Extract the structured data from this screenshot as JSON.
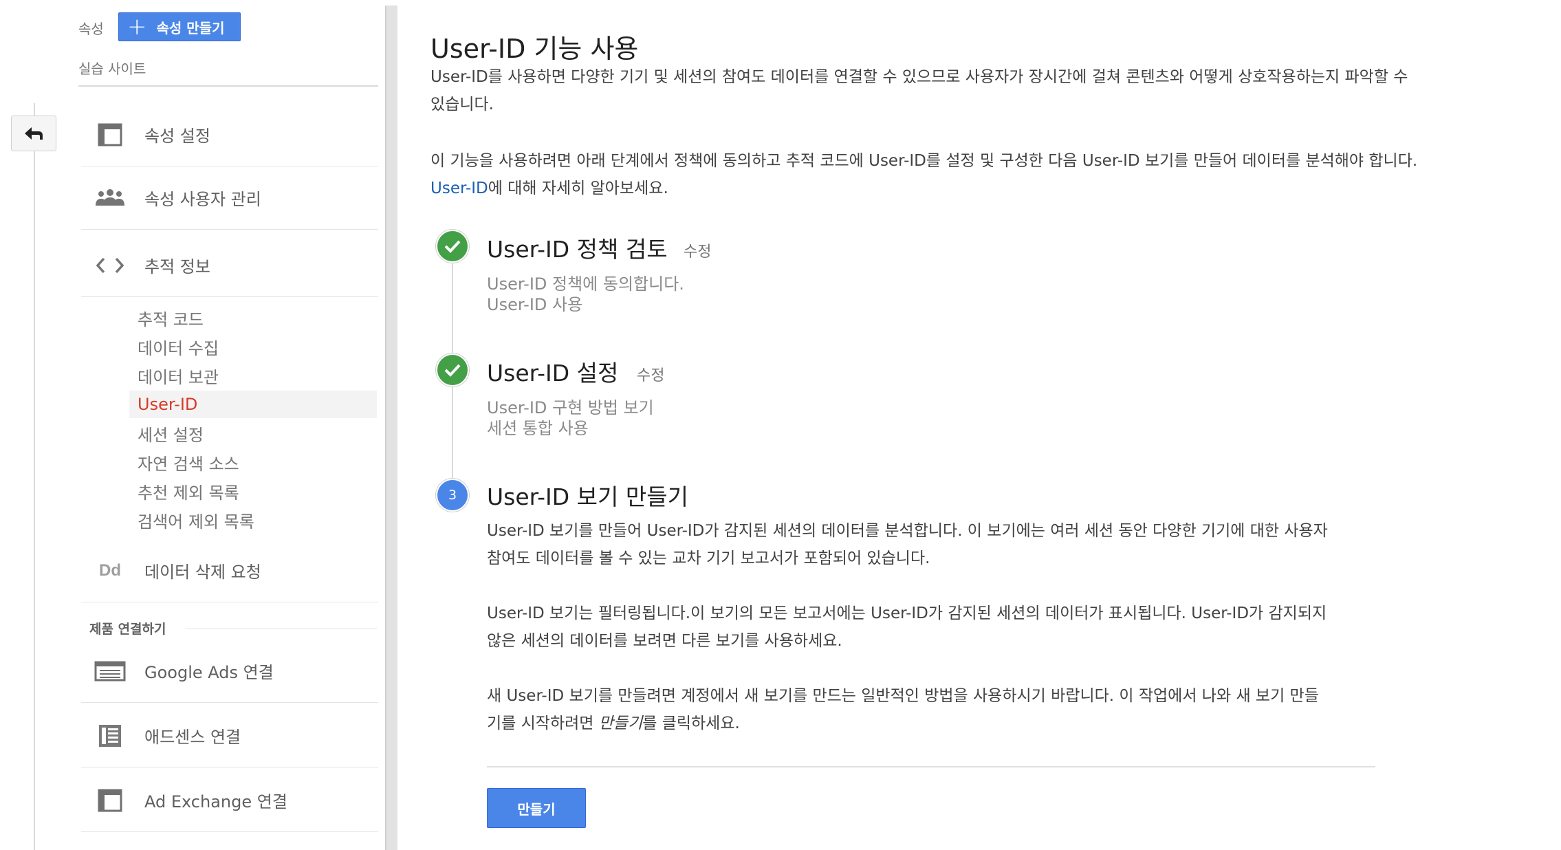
{
  "sidebar": {
    "property_label": "속성",
    "create_property_label": "속성 만들기",
    "site_name": "실습 사이트",
    "items": [
      {
        "label": "속성 설정"
      },
      {
        "label": "속성 사용자 관리"
      },
      {
        "label": "추적 정보"
      },
      {
        "label": "데이터 삭제 요청"
      },
      {
        "label": "Google Ads 연결"
      },
      {
        "label": "애드센스 연결"
      },
      {
        "label": "Ad Exchange 연결"
      }
    ],
    "subitems": [
      "추적 코드",
      "데이터 수집",
      "데이터 보관",
      "User-ID",
      "세션 설정",
      "자연 검색 소스",
      "추천 제외 목록",
      "검색어 제외 목록"
    ],
    "active_subitem": "User-ID",
    "section_label": "제품 연결하기"
  },
  "main": {
    "title": "User-ID 기능 사용",
    "intro_line1": "User-ID를 사용하면 다양한 기기 및 세션의 참여도 데이터를 연결할 수 있으므로 사용자가 장시간에 걸쳐 콘텐츠와 어떻게 상호작용하는지 파악할 수",
    "intro_line2": "있습니다.",
    "intro2_line1": "이 기능을 사용하려면 아래 단계에서 정책에 동의하고 추적 코드에 User-ID를 설정 및 구성한 다음 User-ID 보기를 만들어 데이터를 분석해야 합니다.",
    "learn_more_link": "User-ID",
    "learn_more_rest": "에 대해 자세히 알아보세요.",
    "steps": [
      {
        "title": "User-ID 정책 검토",
        "edit": "수정",
        "details": [
          "User-ID 정책에 동의합니다.",
          "User-ID 사용"
        ]
      },
      {
        "title": "User-ID 설정",
        "edit": "수정",
        "details": [
          "User-ID 구현 방법 보기",
          "세션 통합 사용"
        ]
      },
      {
        "number": "3",
        "title": "User-ID 보기 만들기"
      }
    ],
    "step3_p1_l1": "User-ID 보기를 만들어 User-ID가 감지된 세션의 데이터를 분석합니다. 이 보기에는 여러 세션 동안 다양한 기기에 대한 사용자",
    "step3_p1_l2": "참여도 데이터를 볼 수 있는 교차 기기 보고서가 포함되어 있습니다.",
    "step3_p2_l1": "User-ID 보기는 필터링됩니다.이 보기의 모든 보고서에는 User-ID가 감지된 세션의 데이터가 표시됩니다. User-ID가 감지되지",
    "step3_p2_l2": "않은 세션의 데이터를 보려면 다른 보기를 사용하세요.",
    "step3_p3_l1": "새 User-ID 보기를 만들려면 계정에서 새 보기를 만드는 일반적인 방법을 사용하시기 바랍니다. 이 작업에서 나와 새 보기 만들",
    "step3_p3_l2_pre": "기를 시작하려면 ",
    "step3_p3_l2_em": "만들기",
    "step3_p3_l2_post": "를 클릭하세요.",
    "create_button": "만들기"
  },
  "colors": {
    "accent": "#4a86e8",
    "active": "#d73a27",
    "success": "#43a047",
    "link": "#1a5fb4"
  }
}
